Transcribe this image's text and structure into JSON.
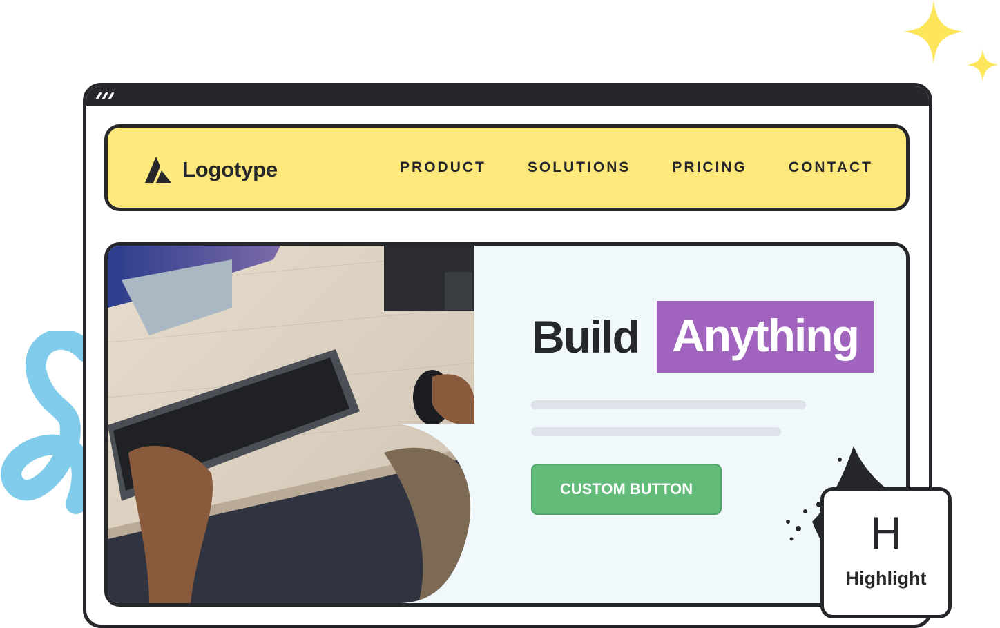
{
  "brand": {
    "logo_text": "Logotype",
    "logo_icon": "mountain-logo-icon"
  },
  "nav": {
    "items": [
      {
        "label": "PRODUCT"
      },
      {
        "label": "SOLUTIONS"
      },
      {
        "label": "PRICING"
      },
      {
        "label": "CONTACT"
      }
    ]
  },
  "hero": {
    "headline_plain": "Build",
    "headline_highlight": "Anything",
    "cta_label": "CUSTOM BUTTON",
    "image": "desk-workspace-photo"
  },
  "highlight_card": {
    "letter": "H",
    "label": "Highlight"
  },
  "colors": {
    "navbar_bg": "#fde87c",
    "outline": "#26272b",
    "hero_bg": "#f1f8fc",
    "highlight_bg": "#a064bf",
    "button_bg": "#62bb79",
    "sparkle": "#fde65c",
    "squiggle": "#7ac8ea"
  }
}
